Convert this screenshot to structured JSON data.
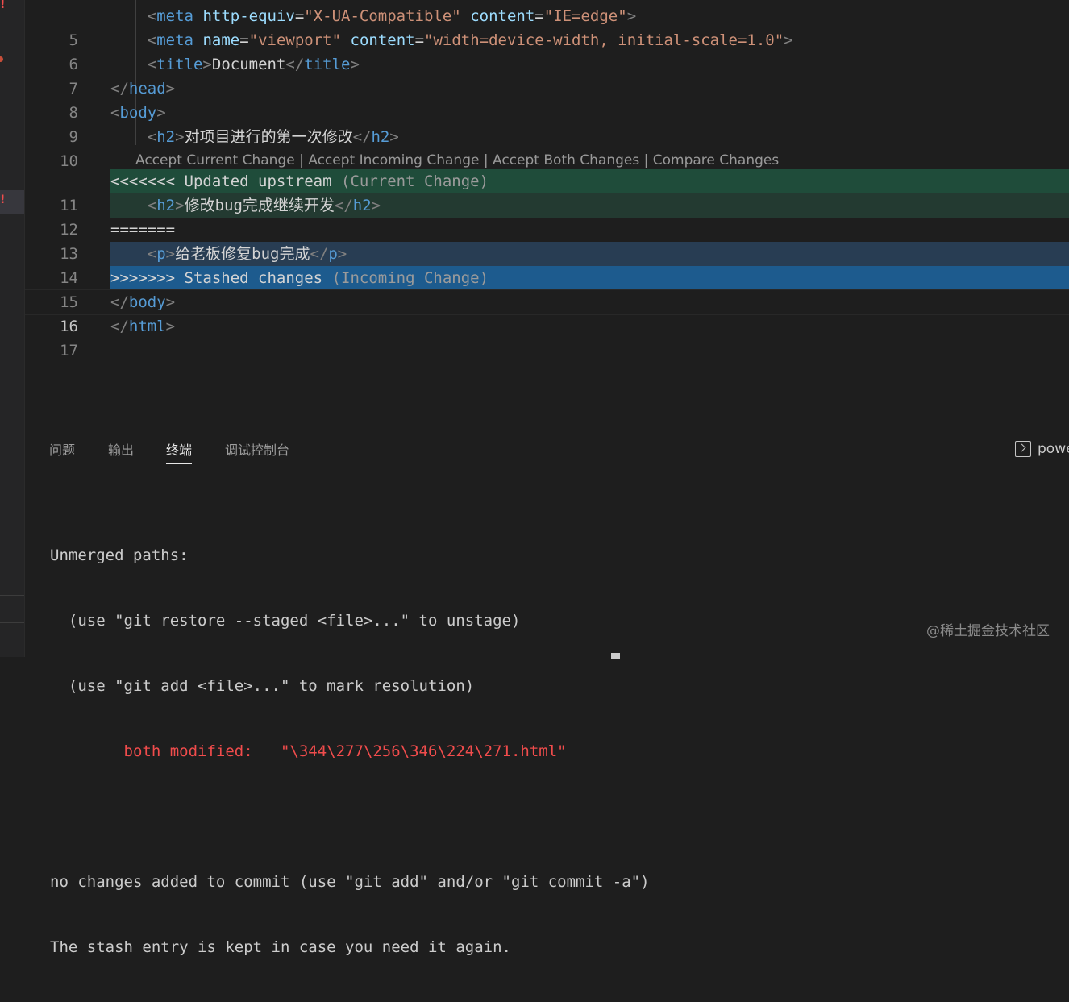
{
  "activity_bar": {
    "marker": "!",
    "marker2": "!"
  },
  "editor": {
    "lines": [
      {
        "num": "5",
        "indent": "    ",
        "open": "<",
        "tag": "meta",
        "attr1": "http-equiv",
        "eq1": "=",
        "val1": "\"X-UA-Compatible\"",
        "attr2": "content",
        "eq2": "=",
        "val2": "\"IE=edge\"",
        "close": ">"
      },
      {
        "num": "6",
        "indent": "    ",
        "open": "<",
        "tag": "meta",
        "attr1": "name",
        "eq1": "=",
        "val1": "\"viewport\"",
        "attr2": "content",
        "eq2": "=",
        "val2": "\"width=device-width, initial-scale=1.0\"",
        "close": ">"
      },
      {
        "num": "7",
        "indent": "    ",
        "open": "<",
        "tag": "title",
        "close": ">",
        "text": "Document",
        "end_open": "</",
        "end_tag": "title",
        "end_close": ">"
      },
      {
        "num": "8",
        "open": "</",
        "tag": "head",
        "close": ">"
      },
      {
        "num": "9",
        "open": "<",
        "tag": "body",
        "close": ">"
      },
      {
        "num": "10",
        "indent": "    ",
        "open": "<",
        "tag": "h2",
        "close": ">",
        "text": "对项目进行的第一次修改",
        "end_open": "</",
        "end_tag": "h2",
        "end_close": ">"
      },
      {
        "num": "11",
        "marker": "<<<<<<< Updated upstream",
        "hint": "(Current Change)"
      },
      {
        "num": "12",
        "indent": "    ",
        "open": "<",
        "tag": "h2",
        "close": ">",
        "text": "修改bug完成继续开发",
        "end_open": "</",
        "end_tag": "h2",
        "end_close": ">"
      },
      {
        "num": "13",
        "marker": "======="
      },
      {
        "num": "14",
        "indent": "    ",
        "open": "<",
        "tag": "p",
        "close": ">",
        "text": "给老板修复bug完成",
        "end_open": "</",
        "end_tag": "p",
        "end_close": ">"
      },
      {
        "num": "15",
        "marker": ">>>>>>> Stashed changes",
        "hint": "(Incoming Change)"
      },
      {
        "num": "16",
        "open": "</",
        "tag": "body",
        "close": ">"
      },
      {
        "num": "17",
        "open": "</",
        "tag": "html",
        "close": ">"
      }
    ],
    "codelens": {
      "accept_current": "Accept Current Change",
      "accept_incoming": "Accept Incoming Change",
      "accept_both": "Accept Both Changes",
      "compare": "Compare Changes",
      "sep": " | "
    }
  },
  "panel": {
    "tabs": {
      "problems": "问题",
      "output": "输出",
      "terminal": "终端",
      "debug_console": "调试控制台"
    },
    "terminal_shell": "powe",
    "terminal_lines": [
      "Unmerged paths:",
      "  (use \"git restore --staged <file>...\" to unstage)",
      "  (use \"git add <file>...\" to mark resolution)",
      "        both modified:   \"\\344\\277\\256\\346\\224\\271.html\"",
      "",
      "no changes added to commit (use \"git add\" and/or \"git commit -a\")",
      "The stash entry is kept in case you need it again."
    ]
  },
  "watermark": "@稀土掘金技术社区",
  "colors": {
    "current_header": "#1f4c3a",
    "current_body": "#233a31",
    "incoming_body": "#283d53",
    "incoming_header": "#1d5b8e",
    "error_red": "#f14c4c"
  }
}
